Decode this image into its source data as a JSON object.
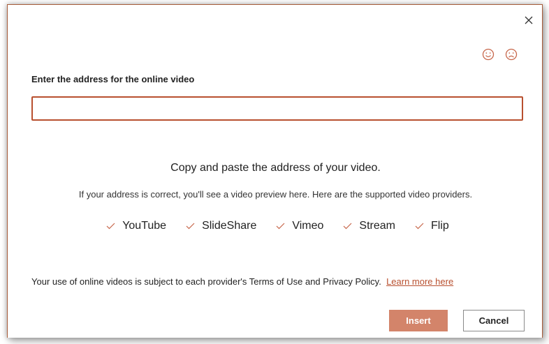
{
  "dialog": {
    "field_label": "Enter the address for the online video",
    "address_value": "",
    "address_placeholder": "",
    "copy_title": "Copy and paste the address of your video.",
    "preview_desc": "If your address is correct, you'll see a video preview here. Here are the supported video providers.",
    "providers": [
      {
        "label": "YouTube"
      },
      {
        "label": "SlideShare"
      },
      {
        "label": "Vimeo"
      },
      {
        "label": "Stream"
      },
      {
        "label": "Flip"
      }
    ],
    "terms_text": "Your use of online videos is subject to each provider's Terms of Use and Privacy Policy.",
    "learn_more_label": "Learn more here",
    "insert_label": "Insert",
    "cancel_label": "Cancel"
  },
  "colors": {
    "accent": "#b8502f",
    "check": "#c7664a",
    "insert_bg": "#d3846a",
    "link": "#b8502f"
  }
}
